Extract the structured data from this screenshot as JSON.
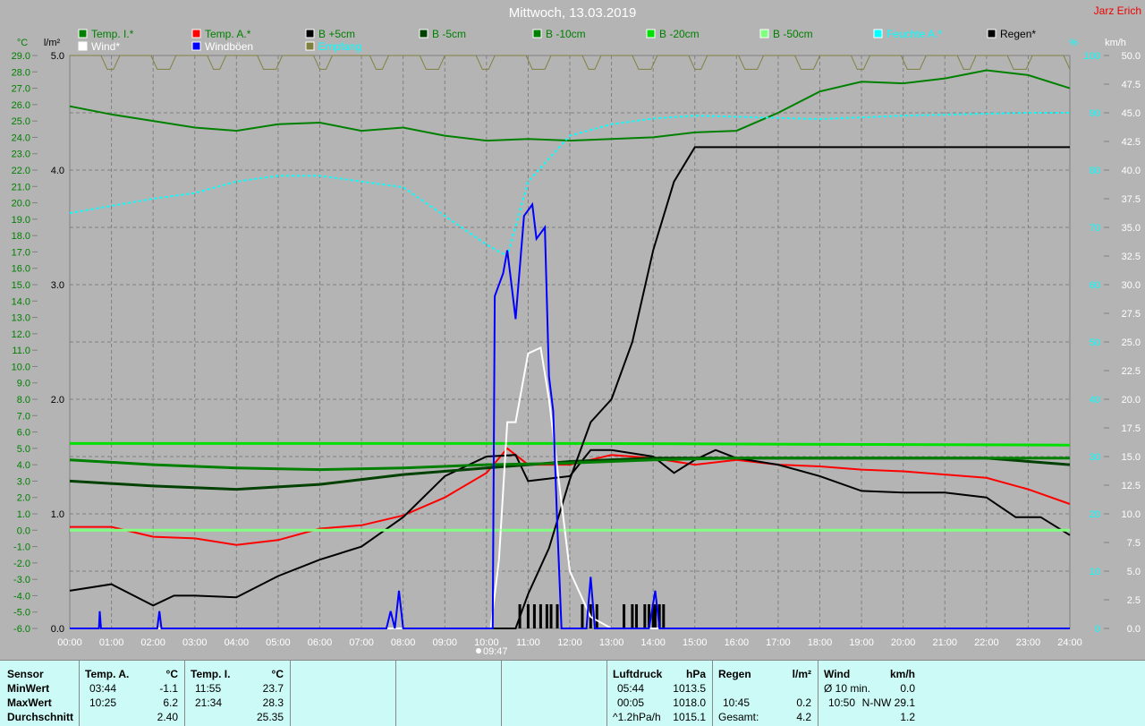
{
  "title": "Mittwoch, 13.03.2019",
  "author": "Jarz Erich",
  "sunrise_marker": "09:47",
  "chart_data": {
    "type": "line",
    "title": "Mittwoch, 13.03.2019",
    "x_unit": "hours",
    "xlim": [
      0,
      24
    ],
    "x_ticks": [
      "00:00",
      "01:00",
      "02:00",
      "03:00",
      "04:00",
      "05:00",
      "06:00",
      "07:00",
      "08:00",
      "09:00",
      "10:00",
      "11:00",
      "12:00",
      "13:00",
      "14:00",
      "15:00",
      "16:00",
      "17:00",
      "18:00",
      "19:00",
      "20:00",
      "21:00",
      "22:00",
      "23:00",
      "24:00"
    ],
    "axes": {
      "temp": {
        "label": "°C",
        "range": [
          -6,
          29
        ],
        "step": 1,
        "color": "#008000"
      },
      "rain": {
        "label": "l/m²",
        "range": [
          0,
          5
        ],
        "step": 1,
        "color": "#000000"
      },
      "humidity": {
        "label": "%",
        "range": [
          0,
          100
        ],
        "step": 10,
        "color": "#00ffff"
      },
      "wind": {
        "label": "km/h",
        "range": [
          0,
          50
        ],
        "step": 2.5,
        "color": "#000000"
      }
    },
    "grid": true,
    "legend_position": "top",
    "series": [
      {
        "name": "Temp. I.*",
        "axis": "temp",
        "color": "#008000",
        "label_color": "#008000",
        "points": [
          [
            0,
            25.9
          ],
          [
            1,
            25.4
          ],
          [
            2,
            25.0
          ],
          [
            3,
            24.6
          ],
          [
            4,
            24.4
          ],
          [
            5,
            24.8
          ],
          [
            6,
            24.9
          ],
          [
            7,
            24.4
          ],
          [
            8,
            24.6
          ],
          [
            9,
            24.1
          ],
          [
            10,
            23.8
          ],
          [
            11,
            23.9
          ],
          [
            12,
            23.8
          ],
          [
            13,
            23.9
          ],
          [
            14,
            24.0
          ],
          [
            15,
            24.3
          ],
          [
            16,
            24.4
          ],
          [
            17,
            25.5
          ],
          [
            18,
            26.8
          ],
          [
            19,
            27.4
          ],
          [
            20,
            27.3
          ],
          [
            21,
            27.6
          ],
          [
            22,
            28.1
          ],
          [
            23,
            27.8
          ],
          [
            24,
            27.0
          ]
        ]
      },
      {
        "name": "Temp. A.*",
        "axis": "temp",
        "color": "#ff0000",
        "label_color": "#008000",
        "points": [
          [
            0,
            0.2
          ],
          [
            1,
            0.2
          ],
          [
            2,
            -0.4
          ],
          [
            3,
            -0.5
          ],
          [
            4,
            -0.9
          ],
          [
            5,
            -0.6
          ],
          [
            6,
            0.1
          ],
          [
            7,
            0.3
          ],
          [
            8,
            0.9
          ],
          [
            9,
            2.0
          ],
          [
            10,
            3.5
          ],
          [
            10.5,
            5.0
          ],
          [
            11,
            4.0
          ],
          [
            12,
            4.0
          ],
          [
            13,
            4.6
          ],
          [
            14,
            4.4
          ],
          [
            15,
            4.0
          ],
          [
            16,
            4.3
          ],
          [
            17,
            4.0
          ],
          [
            18,
            3.9
          ],
          [
            19,
            3.7
          ],
          [
            20,
            3.6
          ],
          [
            21,
            3.4
          ],
          [
            22,
            3.2
          ],
          [
            23,
            2.5
          ],
          [
            24,
            1.6
          ]
        ]
      },
      {
        "name": "B +5cm",
        "axis": "temp",
        "color": "#000000",
        "label_color": "#008000",
        "points": [
          [
            0,
            -3.7
          ],
          [
            1,
            -3.3
          ],
          [
            2,
            -4.6
          ],
          [
            2.5,
            -4.0
          ],
          [
            3,
            -4.0
          ],
          [
            4,
            -4.1
          ],
          [
            5,
            -2.8
          ],
          [
            6,
            -1.8
          ],
          [
            7,
            -1.0
          ],
          [
            8,
            0.8
          ],
          [
            9,
            3.3
          ],
          [
            10,
            4.5
          ],
          [
            10.7,
            4.6
          ],
          [
            11,
            3.0
          ],
          [
            12,
            3.3
          ],
          [
            12.5,
            4.9
          ],
          [
            13,
            4.9
          ],
          [
            14,
            4.5
          ],
          [
            14.5,
            3.5
          ],
          [
            15,
            4.3
          ],
          [
            15.5,
            4.9
          ],
          [
            16,
            4.4
          ],
          [
            17,
            4.0
          ],
          [
            18,
            3.3
          ],
          [
            19,
            2.4
          ],
          [
            20,
            2.3
          ],
          [
            21,
            2.3
          ],
          [
            22,
            2.0
          ],
          [
            22.7,
            0.8
          ],
          [
            23.3,
            0.8
          ],
          [
            24,
            -0.3
          ]
        ]
      },
      {
        "name": "B -5cm",
        "axis": "temp",
        "color": "#004000",
        "label_color": "#008000",
        "points": [
          [
            0,
            3.0
          ],
          [
            2,
            2.7
          ],
          [
            4,
            2.5
          ],
          [
            6,
            2.8
          ],
          [
            8,
            3.4
          ],
          [
            10,
            3.8
          ],
          [
            12,
            4.2
          ],
          [
            14,
            4.4
          ],
          [
            16,
            4.4
          ],
          [
            18,
            4.4
          ],
          [
            20,
            4.4
          ],
          [
            22,
            4.4
          ],
          [
            24,
            4.0
          ]
        ]
      },
      {
        "name": "B -10cm",
        "axis": "temp",
        "color": "#008000",
        "label_color": "#008000",
        "points": [
          [
            0,
            4.3
          ],
          [
            2,
            4.0
          ],
          [
            4,
            3.8
          ],
          [
            6,
            3.7
          ],
          [
            8,
            3.8
          ],
          [
            10,
            4.0
          ],
          [
            12,
            4.1
          ],
          [
            14,
            4.3
          ],
          [
            16,
            4.4
          ],
          [
            18,
            4.4
          ],
          [
            20,
            4.4
          ],
          [
            22,
            4.4
          ],
          [
            24,
            4.4
          ]
        ]
      },
      {
        "name": "B -20cm",
        "axis": "temp",
        "color": "#00e000",
        "label_color": "#008000",
        "points": [
          [
            0,
            5.3
          ],
          [
            12,
            5.3
          ],
          [
            24,
            5.2
          ]
        ]
      },
      {
        "name": "B -50cm",
        "axis": "temp",
        "color": "#80ff80",
        "label_color": "#008000",
        "points": [
          [
            0,
            0.0
          ],
          [
            24,
            0.0
          ]
        ]
      },
      {
        "name": "Feuchte A.*",
        "axis": "humidity",
        "color": "#00ffff",
        "label_color": "#00ffff",
        "dashed": true,
        "points": [
          [
            0,
            72.5
          ],
          [
            2,
            75
          ],
          [
            3,
            76
          ],
          [
            4,
            78
          ],
          [
            5,
            79
          ],
          [
            6,
            79
          ],
          [
            7,
            78
          ],
          [
            8,
            77
          ],
          [
            9,
            72
          ],
          [
            10,
            67
          ],
          [
            10.5,
            65
          ],
          [
            11,
            78
          ],
          [
            12,
            86
          ],
          [
            13,
            88
          ],
          [
            14,
            89
          ],
          [
            15,
            89.5
          ],
          [
            18,
            88.9
          ],
          [
            20,
            89.5
          ],
          [
            23,
            90
          ],
          [
            24,
            90
          ]
        ]
      },
      {
        "name": "Regen*",
        "axis": "rain",
        "color": "#000000",
        "label_color": "#000000",
        "points": [
          [
            0,
            0
          ],
          [
            10.7,
            0
          ],
          [
            11,
            0.3
          ],
          [
            11.5,
            0.7
          ],
          [
            12,
            1.3
          ],
          [
            12.5,
            1.8
          ],
          [
            13,
            2.0
          ],
          [
            13.5,
            2.5
          ],
          [
            14,
            3.3
          ],
          [
            14.5,
            3.9
          ],
          [
            15,
            4.2
          ],
          [
            24,
            4.2
          ]
        ]
      },
      {
        "name": "Wind*",
        "axis": "wind",
        "color": "#ffffff",
        "label_color": "#ffffff",
        "points": [
          [
            0,
            0
          ],
          [
            10.1,
            0
          ],
          [
            10.3,
            6
          ],
          [
            10.5,
            18
          ],
          [
            10.7,
            18
          ],
          [
            11,
            24
          ],
          [
            11.3,
            24.5
          ],
          [
            11.5,
            20
          ],
          [
            12,
            5
          ],
          [
            12.5,
            1
          ],
          [
            13,
            0
          ],
          [
            24,
            0
          ]
        ]
      },
      {
        "name": "Windböen",
        "axis": "wind",
        "color": "#0000ff",
        "label_color": "#ffffff",
        "points": [
          [
            0,
            0
          ],
          [
            0.7,
            0
          ],
          [
            0.72,
            1.5
          ],
          [
            0.75,
            0
          ],
          [
            2.1,
            0
          ],
          [
            2.15,
            1.5
          ],
          [
            2.2,
            0
          ],
          [
            7.6,
            0
          ],
          [
            7.7,
            1.5
          ],
          [
            7.8,
            0
          ],
          [
            7.9,
            3.3
          ],
          [
            8.0,
            0
          ],
          [
            10.15,
            0
          ],
          [
            10.2,
            29
          ],
          [
            10.4,
            31
          ],
          [
            10.5,
            33
          ],
          [
            10.6,
            30
          ],
          [
            10.7,
            27
          ],
          [
            10.9,
            36
          ],
          [
            11.1,
            37
          ],
          [
            11.2,
            34
          ],
          [
            11.4,
            35
          ],
          [
            11.5,
            22
          ],
          [
            11.6,
            19
          ],
          [
            11.7,
            9
          ],
          [
            11.8,
            0
          ],
          [
            12.4,
            0
          ],
          [
            12.5,
            4.5
          ],
          [
            12.6,
            0
          ],
          [
            13.9,
            0
          ],
          [
            14.05,
            3.3
          ],
          [
            14.15,
            0
          ],
          [
            24,
            0
          ]
        ]
      },
      {
        "name": "Empfang",
        "axis": "rain",
        "color": "#808040",
        "label_color": "#00ffff",
        "points": [
          [
            0,
            5.0
          ],
          [
            24,
            5.0
          ]
        ]
      }
    ],
    "rain_event_hours": [
      10.8,
      11.0,
      11.15,
      11.3,
      11.45,
      11.55,
      11.7,
      12.3,
      12.5,
      12.65,
      13.3,
      13.5,
      13.6,
      13.8,
      13.9,
      14.0,
      14.05,
      14.15,
      14.25
    ]
  },
  "table": {
    "sensor": {
      "h": "Sensor",
      "min": "MinWert",
      "max": "MaxWert",
      "avg": "Durchschnitt"
    },
    "temp_a": {
      "h": "Temp. A.",
      "u": "°C",
      "min_t": "03:44",
      "min": "-1.1",
      "max_t": "10:25",
      "max": "6.2",
      "avg": "2.40"
    },
    "temp_i": {
      "h": "Temp. I.",
      "u": "°C",
      "min_t": "11:55",
      "min": "23.7",
      "max_t": "21:34",
      "max": "28.3",
      "avg": "25.35"
    },
    "pressure": {
      "h": "Luftdruck",
      "u": "hPa",
      "min_t": "05:44",
      "min": "1013.5",
      "max_t": "00:05",
      "max": "1018.0",
      "avg_t": "^1.2hPa/h",
      "avg": "1015.1"
    },
    "rain": {
      "h": "Regen",
      "u": "l/m²",
      "max_t": "10:45",
      "max": "0.2",
      "avg_t": "Gesamt:",
      "avg": "4.2"
    },
    "wind": {
      "h": "Wind",
      "u": "km/h",
      "min_t": "Ø 10 min.",
      "min": "0.0",
      "max_t": "10:50",
      "max": "N-NW 29.1",
      "avg": "1.2"
    }
  }
}
